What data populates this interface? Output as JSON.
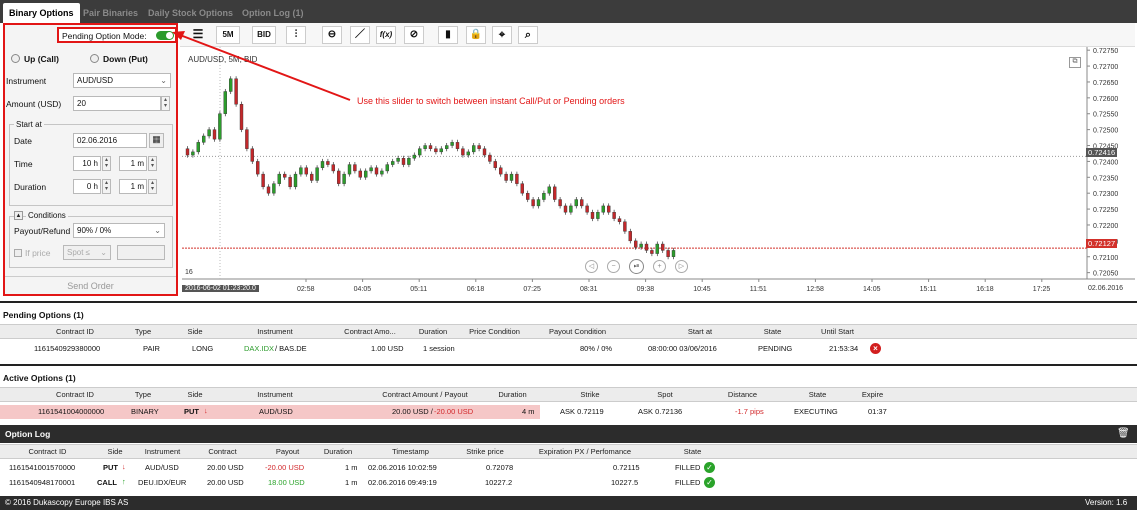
{
  "tabs": [
    "Binary Options",
    "Pair Binaries",
    "Daily Stock Options",
    "Option Log (1)"
  ],
  "panel": {
    "pending_mode_label": "Pending Option Mode:",
    "up": "Up (Call)",
    "down": "Down (Put)",
    "instrument_label": "Instrument",
    "instrument_value": "AUD/USD",
    "amount_label": "Amount (USD)",
    "amount_value": "20",
    "start_at": "Start at",
    "date_label": "Date",
    "date_value": "02.06.2016",
    "time_label": "Time",
    "time_h": "10",
    "time_m": "1",
    "unit_h": "h",
    "unit_m": "m",
    "duration_label": "Duration",
    "dur_h": "0",
    "dur_m": "1",
    "conditions": "Conditions",
    "payout_label": "Payout/Refund",
    "payout_value": "90% / 0%",
    "if_price": "If price",
    "spot": "Spot ≤",
    "send": "Send Order"
  },
  "toolbar": {
    "period": "5M",
    "side": "BID",
    "fx": "f(x)"
  },
  "annotation": "Use this slider to switch between instant Call/Put or Pending orders",
  "chart": {
    "title": "AUD/USD, 5M, BID",
    "y_ticks": [
      "0.72750",
      "0.72700",
      "0.72650",
      "0.72600",
      "0.72550",
      "0.72500",
      "0.72450",
      "0.72400",
      "0.72350",
      "0.72300",
      "0.72250",
      "0.72200",
      "0.72150",
      "0.72100",
      "0.72050"
    ],
    "x_ticks": [
      "02:58",
      "04:05",
      "05:11",
      "06:18",
      "07:25",
      "08:31",
      "09:38",
      "10:45",
      "11:51",
      "12:58",
      "14:05",
      "15:11",
      "16:18",
      "17:25"
    ],
    "start_label": "2016-06-02 01:23:20.0",
    "end_label": "02.06.2016",
    "small_label": "16",
    "price_tag_1": "0.72416",
    "price_tag_2": "0.72127",
    "up_color": "#2c9c2c",
    "down_color": "#c2282b"
  },
  "pending": {
    "title": "Pending Options (1)",
    "headers": [
      "Contract ID",
      "Type",
      "Side",
      "Instrument",
      "Contract Amo...",
      "Duration",
      "Price Condition",
      "Payout Condition",
      "Start at",
      "State",
      "Until Start"
    ],
    "row": {
      "id": "1161540929380000",
      "type": "PAIR",
      "side": "LONG",
      "inst1": "DAX.IDX",
      "inst2": " / BAS.DE",
      "amount": "1.00 USD",
      "duration": "1 session",
      "payout": "80% / 0%",
      "start": "08:00:00 03/06/2016",
      "state": "PENDING",
      "until": "21:53:34"
    }
  },
  "active": {
    "title": "Active Options (1)",
    "headers": [
      "Contract ID",
      "Type",
      "Side",
      "Instrument",
      "Contract Amount / Payout",
      "Duration",
      "Strike",
      "Spot",
      "Distance",
      "State",
      "Expire"
    ],
    "row": {
      "id": "1161541004000000",
      "type": "BINARY",
      "side": "PUT",
      "inst": "AUD/USD",
      "amount": "20.00 USD / ",
      "payout": "-20.00 USD",
      "duration": "4 m",
      "strike": "ASK 0.72119",
      "spot": "ASK 0.72136",
      "distance": "-1.7 pips",
      "state": "EXECUTING",
      "expire": "01:37"
    }
  },
  "log": {
    "title": "Option Log",
    "headers": [
      "Contract ID",
      "Side",
      "Instrument",
      "Contract",
      "Payout",
      "Duration",
      "Timestamp",
      "Strike price",
      "Expiration PX / Perfomance",
      "State"
    ],
    "rows": [
      {
        "id": "1161541001570000",
        "side": "PUT",
        "inst": "AUD/USD",
        "contract": "20.00 USD",
        "payout": "-20.00 USD",
        "dur": "1 m",
        "ts": "02.06.2016 10:02:59",
        "strike": "0.72078",
        "exp": "0.72115",
        "state": "FILLED"
      },
      {
        "id": "1161540948170001",
        "side": "CALL",
        "inst": "DEU.IDX/EUR",
        "contract": "20.00 USD",
        "payout": "18.00 USD",
        "dur": "1 m",
        "ts": "02.06.2016 09:49:19",
        "strike": "10227.2",
        "exp": "10227.5",
        "state": "FILLED"
      }
    ]
  },
  "footer": {
    "left": "© 2016 Dukascopy Europe IBS AS",
    "right": "Version: 1.6"
  }
}
